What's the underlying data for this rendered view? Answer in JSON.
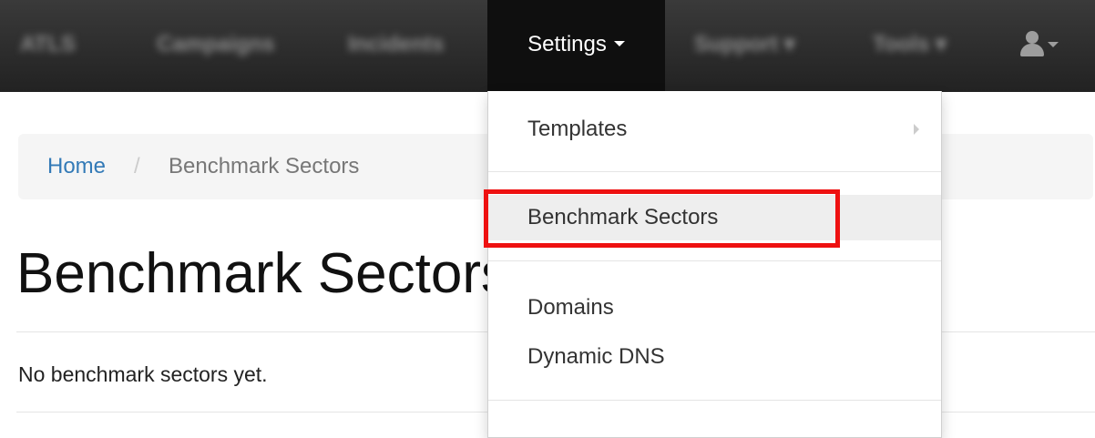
{
  "navbar": {
    "brand": "ATLS",
    "items": [
      {
        "label": "Campaigns"
      },
      {
        "label": "Incidents"
      },
      {
        "label": "Settings",
        "active": true
      },
      {
        "label": "Support"
      },
      {
        "label": "Tools"
      }
    ],
    "user_icon": "user-icon"
  },
  "breadcrumb": {
    "home": "Home",
    "separator": "/",
    "current": "Benchmark Sectors"
  },
  "page": {
    "title": "Benchmark Sectors",
    "empty_message": "No benchmark sectors yet."
  },
  "settings_menu": {
    "items": [
      {
        "label": "Templates",
        "has_submenu": true
      },
      {
        "label": "Benchmark Sectors",
        "highlighted": true
      },
      {
        "label": "Domains"
      },
      {
        "label": "Dynamic DNS"
      }
    ]
  },
  "colors": {
    "navbar_bg": "#222222",
    "link": "#337ab7",
    "highlight_box": "#ee1111"
  }
}
